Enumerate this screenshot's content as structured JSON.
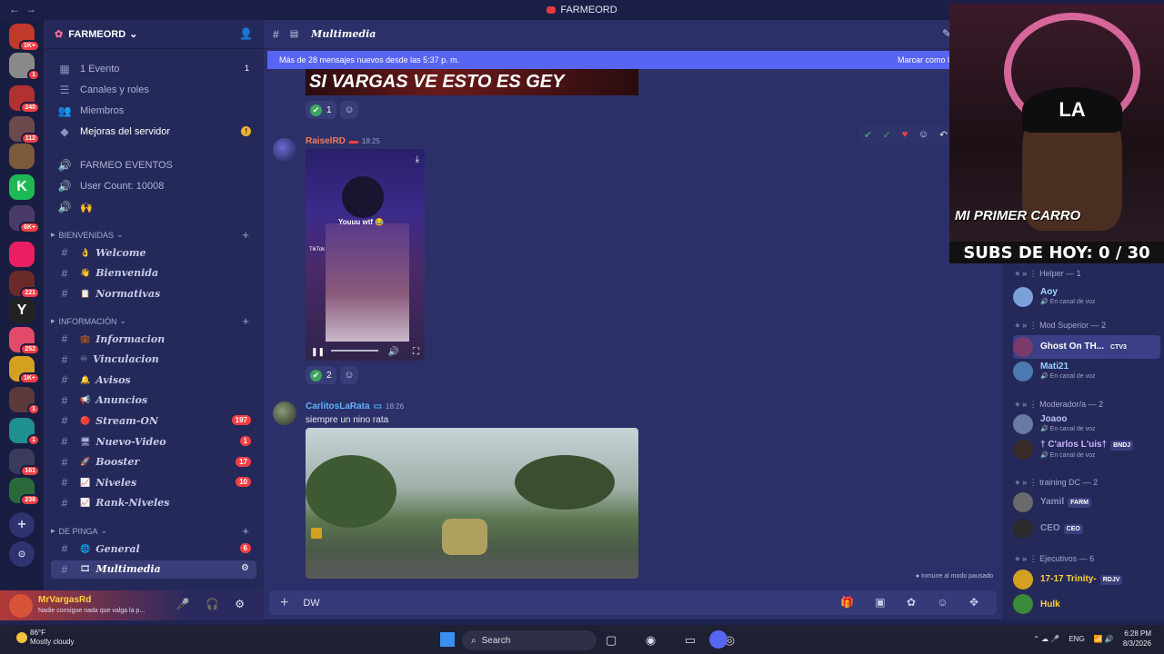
{
  "window": {
    "title": "FARMEORD"
  },
  "servers": [
    {
      "badge": "1K+",
      "color": "#c0392b"
    },
    {
      "badge": "1",
      "color": "#8a8a8a"
    },
    {
      "badge": "240",
      "color": "#b23030"
    },
    {
      "badge": "112",
      "color": "#6a4a4a"
    },
    {
      "badge": "",
      "color": "#7a5a3a"
    },
    {
      "badge": "",
      "color": "#1db954",
      "letter": "K"
    },
    {
      "badge": "6K+",
      "color": "#4a3a6a"
    },
    {
      "badge": "",
      "color": "#e91e63"
    },
    {
      "badge": "221",
      "color": "#6a2a2a"
    },
    {
      "badge": "",
      "color": "#222",
      "letter": "Y"
    },
    {
      "badge": "252",
      "color": "#e34a6a"
    },
    {
      "badge": "1K+",
      "color": "#d4a020"
    },
    {
      "badge": "1",
      "color": "#5a3a3a"
    },
    {
      "badge": "1",
      "color": "#1f8f8f"
    },
    {
      "badge": "161",
      "color": "#3a3a5a"
    },
    {
      "badge": "238",
      "color": "#2a6a3a"
    }
  ],
  "server": {
    "name": "FARMEORD"
  },
  "top_items": [
    {
      "icon": "calendar-icon",
      "glyph": "▦",
      "label": "1 Evento",
      "count": "1"
    },
    {
      "icon": "list-icon",
      "glyph": "☰",
      "label": "Canales y roles"
    },
    {
      "icon": "members-icon",
      "glyph": "👥",
      "label": "Miembros"
    },
    {
      "icon": "boost-icon",
      "glyph": "◆",
      "label": "Mejoras del servidor",
      "warn": "!"
    }
  ],
  "voice_items": [
    {
      "glyph": "🔊",
      "label": "FARMEO EVENTOS"
    },
    {
      "glyph": "🔊",
      "label": "User Count: 10008"
    },
    {
      "glyph": "🔊",
      "label": "🙌"
    }
  ],
  "categories": {
    "bienvenidas": "BIENVENIDAS",
    "informacion": "INFORMACIÓN",
    "depinga": "DE PINGA"
  },
  "channels_a": [
    {
      "emoji": "👌",
      "label": "Welcome"
    },
    {
      "emoji": "👋",
      "label": "Bienvenida"
    },
    {
      "emoji": "📋",
      "label": "Normativas"
    }
  ],
  "channels_b": [
    {
      "emoji": "💼",
      "label": "Informacion"
    },
    {
      "emoji": "♾",
      "label": "Vinculacion"
    },
    {
      "emoji": "🔔",
      "label": "Avisos"
    },
    {
      "emoji": "📢",
      "label": "Anuncios"
    },
    {
      "emoji": "🔴",
      "label": "Stream-ON",
      "badge": "197"
    },
    {
      "emoji": "🖥",
      "label": "Nuevo-Video",
      "badge": "1"
    },
    {
      "emoji": "🚀",
      "label": "Booster",
      "badge": "17"
    },
    {
      "emoji": "📈",
      "label": "Niveles",
      "badge": "10"
    },
    {
      "emoji": "📈",
      "label": "Rank-Niveles"
    }
  ],
  "channels_c": [
    {
      "emoji": "🌐",
      "label": "General",
      "badge": "6"
    },
    {
      "emoji": "🎞",
      "label": "Multimedia"
    }
  ],
  "user": {
    "name": "MrVargasRd",
    "status": "Nadie consigue nada que valga la p..."
  },
  "main": {
    "channel": "Multimedia",
    "new_messages": "Más de 28 mensajes nuevos desde las 5:37 p. m.",
    "mark_read": "Marcar como l",
    "image_caption": "SI VARGAS VE ESTO ES GEY",
    "msg1": {
      "author": "RaiselRD",
      "time": "18:25",
      "video_text": "Youuu wtf 😂",
      "tiktok": "TikTok",
      "reactions": "2"
    },
    "msg0_reactions": "1",
    "msg2": {
      "author": "CarlitosLaRata",
      "time": "18:26",
      "text": "siempre un nino rata"
    },
    "slowmode": "Inmune al modo pausado",
    "composer": "DW"
  },
  "stream": {
    "subs": "SUBS DE HOY: 0 / 30",
    "overlay": "MI PRIMER CARRO"
  },
  "member_groups": [
    {
      "title": "Helper — 1",
      "members": [
        {
          "name": "Aoy",
          "sub": "En canal de voz",
          "color": "#a8d8ff"
        }
      ]
    },
    {
      "title": "Mod Superior — 2",
      "members": [
        {
          "name": "Ghost On TH...",
          "tag": "CTV3",
          "color": "#ffffff"
        },
        {
          "name": "Mati21",
          "sub": "En canal de voz",
          "color": "#9ad0ff"
        }
      ]
    },
    {
      "title": "Moderador/a — 2",
      "members": [
        {
          "name": "Joaoo",
          "sub": "En canal de voz",
          "color": "#b8c4ff"
        },
        {
          "name": "† C'arlos L'uis†",
          "tag": "BNDJ",
          "sub": "En canal de voz",
          "color": "#c9b2ff"
        }
      ]
    },
    {
      "title": "training DC — 2",
      "members": [
        {
          "name": "Yamil",
          "tag": "FARM",
          "color": "#8e93bd"
        },
        {
          "name": "CEO",
          "tag": "CEO",
          "color": "#8e93bd"
        }
      ]
    },
    {
      "title": "Ejecutivos — 6",
      "members": [
        {
          "name": "17-17 Trinity-",
          "tag": "RDJV",
          "color": "#ffd23a"
        },
        {
          "name": "Hulk",
          "color": "#ffd23a"
        }
      ]
    }
  ],
  "taskbar": {
    "temp": "86°F",
    "weather": "Mostly cloudy",
    "search": "Search",
    "lang": "ENG",
    "time": "6:28 PM",
    "date": "8/3/2026"
  }
}
